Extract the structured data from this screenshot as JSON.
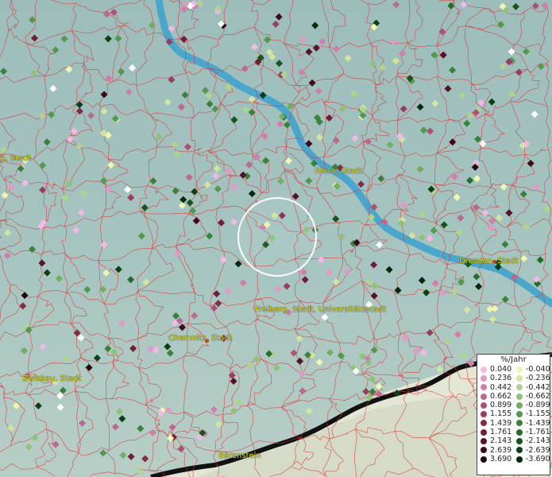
{
  "map": {
    "background": "#a6c3c0",
    "boundary_color": "#e03030",
    "river_color": "#4aa6cc",
    "border_color": "#111111",
    "lowland_color": "#e8ead4"
  },
  "cities": [
    {
      "label": "g, Stadt"
    },
    {
      "label": "Riesa, Stadt"
    },
    {
      "label": "Dresden, Stadt"
    },
    {
      "label": "Freiberg, Stadt, Universitätsstadt"
    },
    {
      "label": "Chemnitz, Stadt"
    },
    {
      "label": "Zwickau, Stadt"
    },
    {
      "label": "Bärenstein"
    }
  ],
  "selection": {
    "shape": "circle",
    "color": "#ffffff"
  },
  "legend": {
    "title": "%/Jahr",
    "positive": [
      {
        "label": "0.040",
        "color": "#f2b8e6"
      },
      {
        "label": "0.236",
        "color": "#e09ac6"
      },
      {
        "label": "0.442",
        "color": "#cf80aa"
      },
      {
        "label": "0.662",
        "color": "#bd6890"
      },
      {
        "label": "0.899",
        "color": "#a95275"
      },
      {
        "label": "1.155",
        "color": "#963e5e"
      },
      {
        "label": "1.439",
        "color": "#822c48"
      },
      {
        "label": "1.761",
        "color": "#6e1e36"
      },
      {
        "label": "2.143",
        "color": "#571226"
      },
      {
        "label": "2.639",
        "color": "#3e0a18"
      },
      {
        "label": "3.690",
        "color": "#24040c"
      }
    ],
    "negative": [
      {
        "label": "-0.040",
        "color": "#eef6b0"
      },
      {
        "label": "-0.236",
        "color": "#cfe6a0"
      },
      {
        "label": "-0.442",
        "color": "#afd48c"
      },
      {
        "label": "-0.662",
        "color": "#8fc276"
      },
      {
        "label": "-0.899",
        "color": "#70ae60"
      },
      {
        "label": "-1.155",
        "color": "#53984c"
      },
      {
        "label": "-1.439",
        "color": "#3a823a"
      },
      {
        "label": "-1.761",
        "color": "#256c2a"
      },
      {
        "label": "-2.143",
        "color": "#16561e"
      },
      {
        "label": "-2.639",
        "color": "#0b4014"
      },
      {
        "label": "-3.690",
        "color": "#04290a"
      }
    ]
  }
}
